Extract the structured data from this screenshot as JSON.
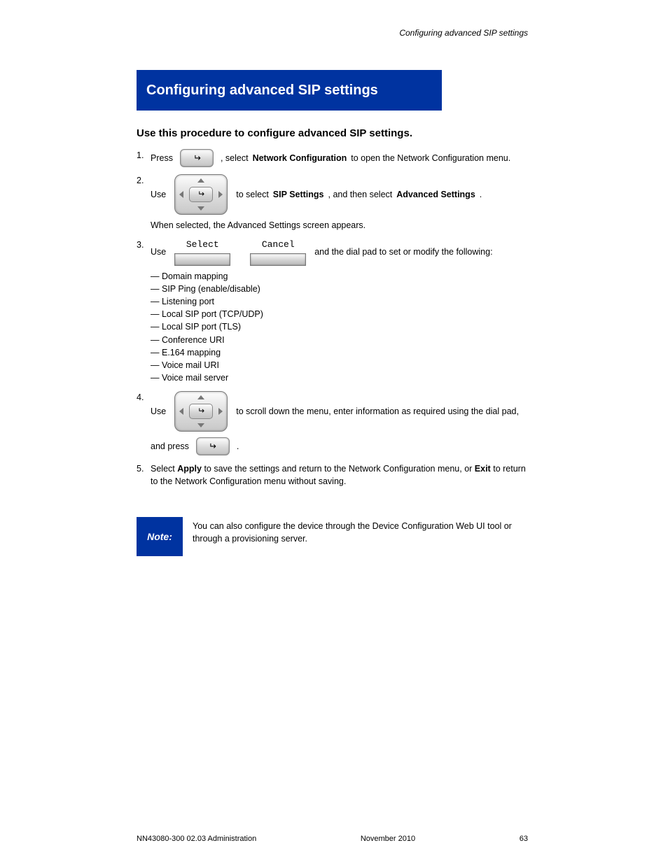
{
  "header": {
    "text": "Configuring advanced SIP settings"
  },
  "title": "Configuring advanced SIP settings",
  "intro": "Use this procedure to configure advanced SIP settings.",
  "step1": {
    "num": "1.",
    "a": "Press",
    "b": ", select",
    "c": "Network Configuration",
    "d": "to open the Network Configuration menu."
  },
  "step2": {
    "num": "2.",
    "a": "Use",
    "b": "to select",
    "c": "SIP Settings",
    "d": ", and then select",
    "e": "Advanced Settings",
    "f": ".",
    "g": "When selected, the Advanced Settings screen appears."
  },
  "step3": {
    "num": "3.",
    "a": "Use",
    "softSelect": "Select",
    "softCancel": "Cancel",
    "b": "and the dial pad to set or modify the following:"
  },
  "fields": [
    "Domain mapping",
    "SIP Ping (enable/disable)",
    "Listening port",
    "Local SIP port (TCP/UDP)",
    "Local SIP port (TLS)",
    "Conference URI",
    "E.164 mapping",
    "Voice mail URI",
    "Voice mail server"
  ],
  "step4": {
    "num": "4.",
    "a": "Use",
    "b": "to scroll down the menu, enter information as required using the dial pad,"
  },
  "step5": {
    "a": "and press",
    "b": "."
  },
  "step5b": {
    "num": "5.",
    "a": "Select",
    "b": "Apply",
    "c": "to save the settings and return to the Network Configuration menu, or",
    "d": "Exit",
    "e": "to return to the Network Configuration menu without saving."
  },
  "note": {
    "label": "Note:",
    "text": "You can also configure the device through the Device Configuration Web UI tool or through a provisioning server."
  },
  "footer": {
    "left": "NN43080-300 02.03 Administration",
    "right": "November 2010",
    "page": "63"
  }
}
